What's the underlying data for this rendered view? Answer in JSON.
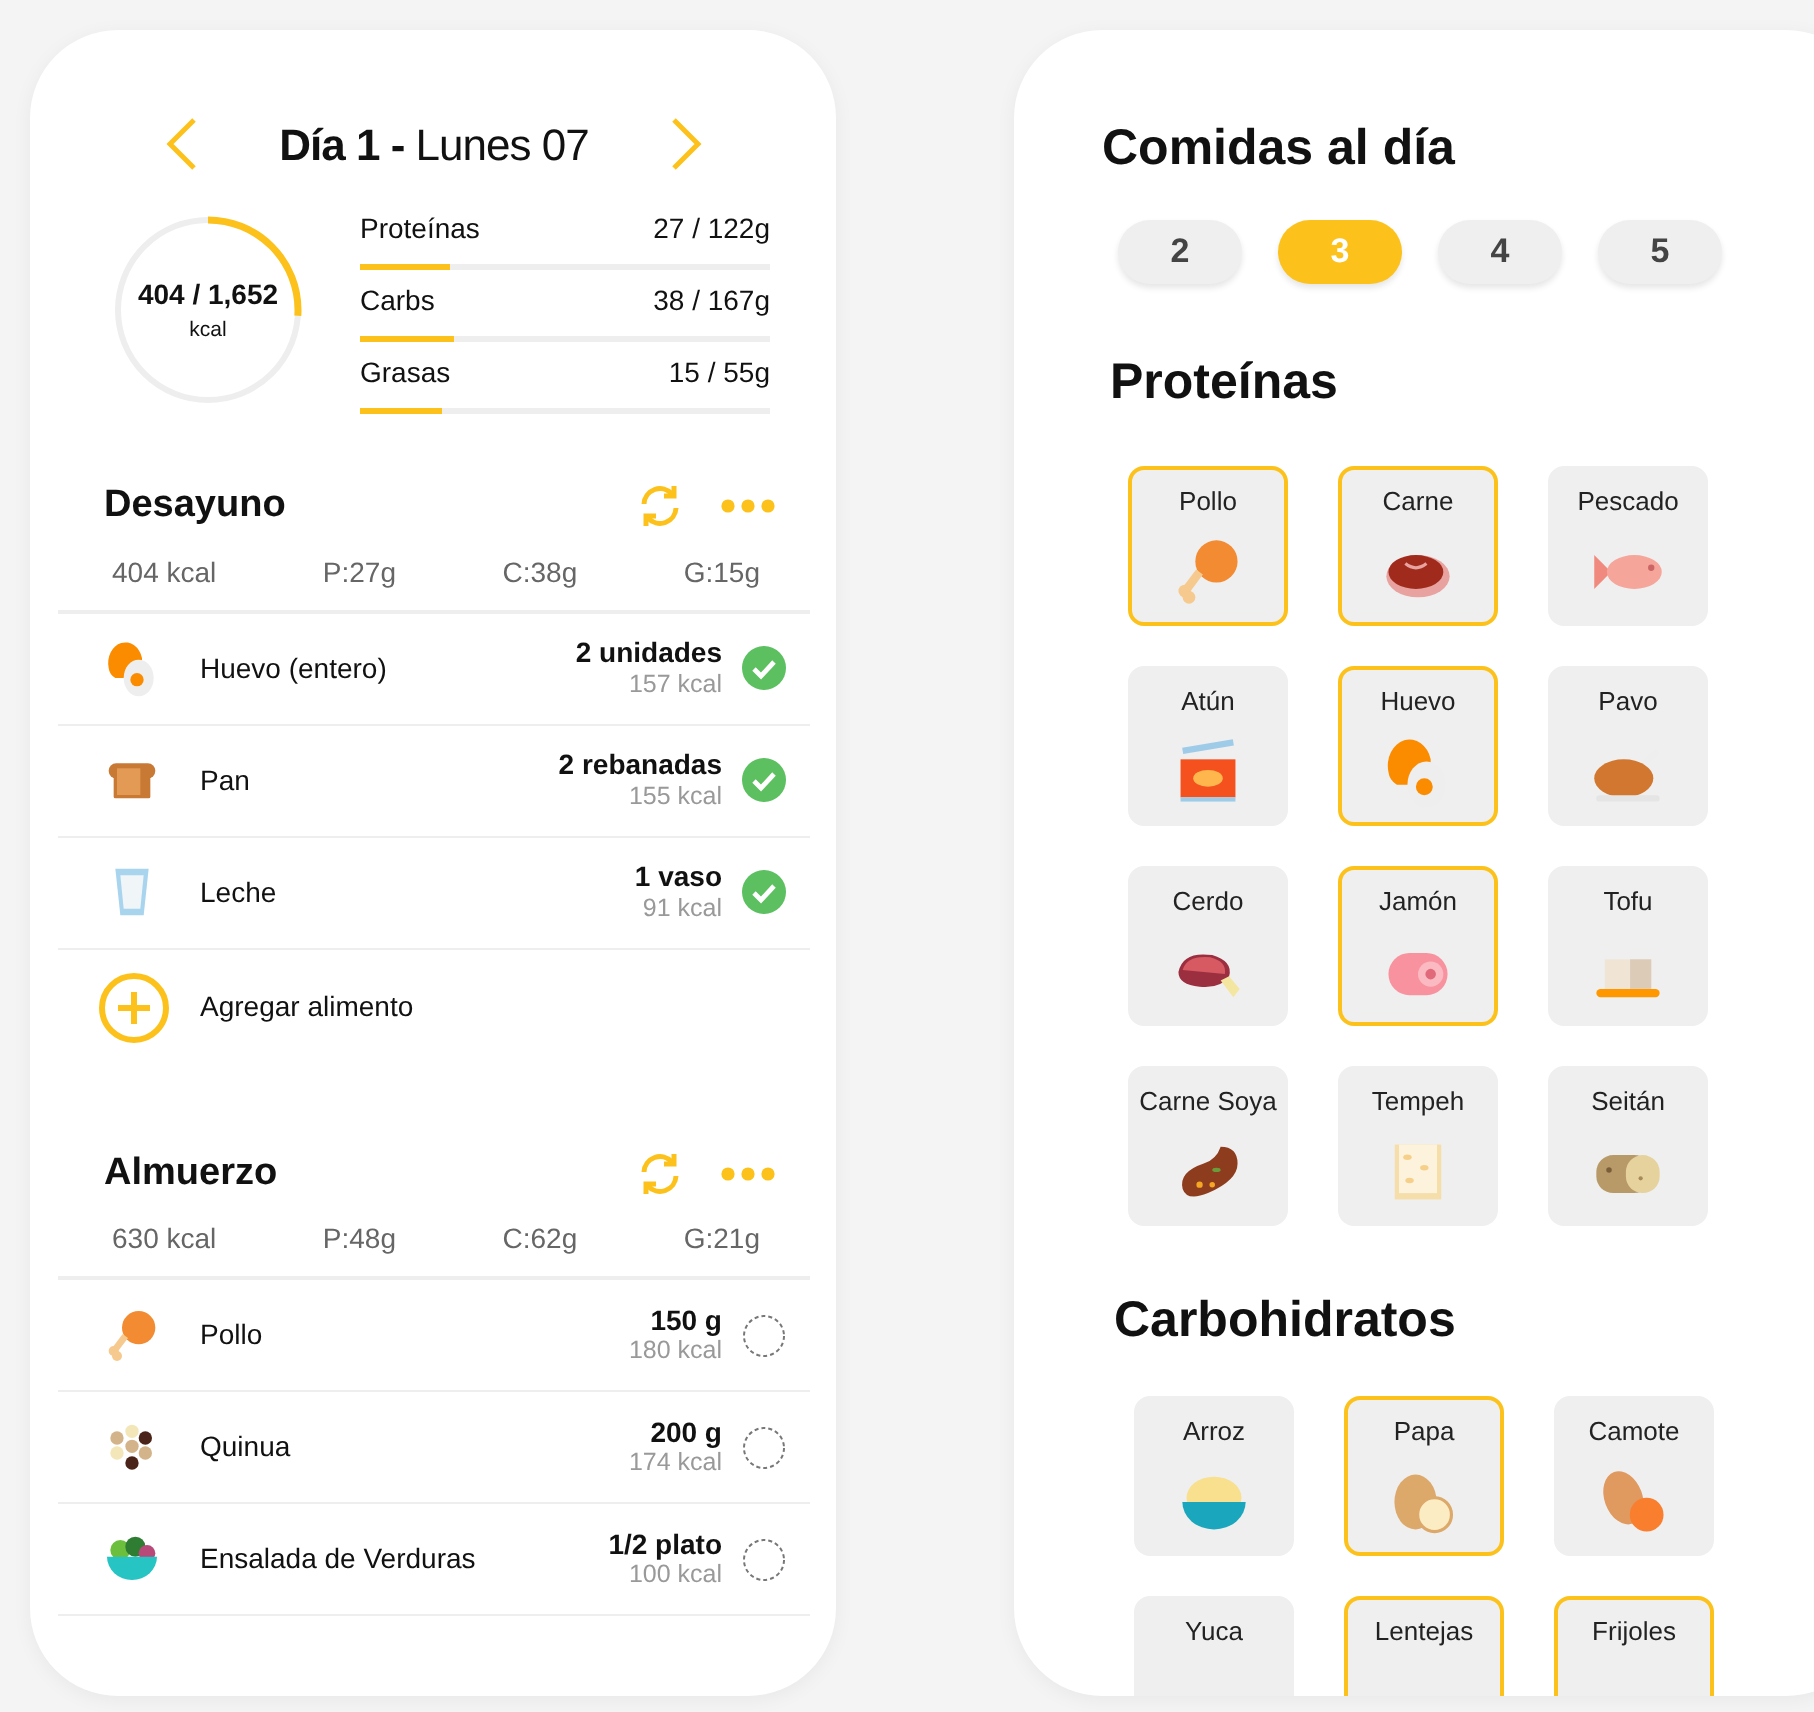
{
  "day_panel": {
    "title": "**Día 1 -** Lunes 07",
    "calories": {
      "value": "404 / 1,652",
      "unit": "kcal",
      "level": 0.26
    },
    "macros": [
      {
        "name": "Proteínas",
        "reading": "27 / 122g",
        "level": 0.22
      },
      {
        "name": "Carbs",
        "reading": "38 / 167g",
        "level": 0.23
      },
      {
        "name": "Grasas",
        "reading": "15 / 55g",
        "level": 0.2
      }
    ],
    "meals": [
      {
        "name": "Desayuno",
        "summary": [
          "404 kcal",
          "P:27g",
          "C:38g",
          "G:15g"
        ],
        "add_label": "Agregar alimento",
        "foods": [
          {
            "name": "Huevo (entero)",
            "amount": "2 unidades",
            "kcal": "157 kcal",
            "checked": true
          },
          {
            "name": "Pan",
            "amount": "2 rebanadas",
            "kcal": "155 kcal",
            "checked": true
          },
          {
            "name": "Leche",
            "amount": "1 vaso",
            "kcal": "91 kcal",
            "checked": true
          }
        ]
      },
      {
        "name": "Almuerzo",
        "summary": [
          "630 kcal",
          "P:48g",
          "C:62g",
          "G:21g"
        ],
        "foods": [
          {
            "name": "Pollo",
            "amount": "150 g",
            "kcal": "180 kcal",
            "checked": false
          },
          {
            "name": "Quinua",
            "amount": "200 g",
            "kcal": "174 kcal",
            "checked": false
          },
          {
            "name": "Ensalada de Verduras",
            "amount": "1/2 plato",
            "kcal": "100 kcal",
            "checked": false
          }
        ]
      }
    ]
  },
  "preferences_panel": {
    "title": "Comidas al día",
    "meal_counts": [
      {
        "label": "2",
        "selected": false
      },
      {
        "label": "3",
        "selected": true
      },
      {
        "label": "4",
        "selected": false
      },
      {
        "label": "5",
        "selected": false
      }
    ],
    "categories": [
      {
        "title": "Proteínas",
        "foods": [
          {
            "name": "Pollo",
            "selected": true
          },
          {
            "name": "Carne",
            "selected": true
          },
          {
            "name": "Pescado",
            "selected": false
          },
          {
            "name": "Atún",
            "selected": false
          },
          {
            "name": "Huevo",
            "selected": true
          },
          {
            "name": "Pavo",
            "selected": false
          },
          {
            "name": "Cerdo",
            "selected": false
          },
          {
            "name": "Jamón",
            "selected": true
          },
          {
            "name": "Tofu",
            "selected": false
          },
          {
            "name": "Carne Soya",
            "selected": false
          },
          {
            "name": "Tempeh",
            "selected": false
          },
          {
            "name": "Seitán",
            "selected": false
          }
        ]
      },
      {
        "title": "Carbohidratos",
        "foods": [
          {
            "name": "Arroz",
            "selected": false
          },
          {
            "name": "Papa",
            "selected": true
          },
          {
            "name": "Camote",
            "selected": false
          },
          {
            "name": "Yuca",
            "selected": false
          },
          {
            "name": "Lentejas",
            "selected": true
          },
          {
            "name": "Frijoles",
            "selected": true
          }
        ]
      }
    ]
  }
}
